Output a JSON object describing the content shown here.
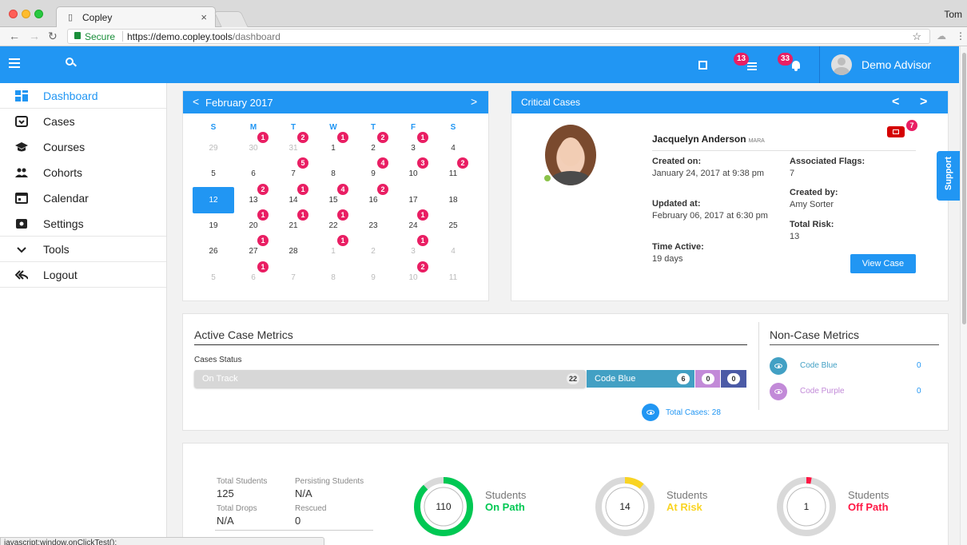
{
  "browser": {
    "tab_title": "Copley",
    "tab_close": "×",
    "profile_name": "Tom",
    "secure_label": "Secure",
    "url_base": "https://demo.copley.tools",
    "url_path": "/dashboard",
    "status_text": "javascript:window.onClickTest();"
  },
  "header": {
    "list_badge": "13",
    "bell_badge": "33",
    "user_name": "Demo Advisor",
    "accent_color": "#2196f3"
  },
  "sidebar": {
    "items": [
      {
        "label": "Dashboard",
        "icon": "dashboard-icon",
        "active": true
      },
      {
        "label": "Cases",
        "icon": "inbox-icon"
      },
      {
        "label": "Courses",
        "icon": "graduation-cap-icon"
      },
      {
        "label": "Cohorts",
        "icon": "group-icon"
      },
      {
        "label": "Calendar",
        "icon": "calendar-icon"
      },
      {
        "label": "Settings",
        "icon": "settings-icon"
      },
      {
        "label": "Tools",
        "icon": "chevron-down-icon"
      },
      {
        "label": "Logout",
        "icon": "reply-all-icon"
      }
    ]
  },
  "calendar": {
    "month": "February 2017",
    "prev": "<",
    "next": ">",
    "dow": [
      "S",
      "M",
      "T",
      "W",
      "T",
      "F",
      "S"
    ],
    "weeks": [
      [
        "29",
        "30",
        "31",
        "1",
        "2",
        "3",
        "4"
      ],
      [
        "5",
        "6",
        "7",
        "8",
        "9",
        "10",
        "11"
      ],
      [
        "12",
        "13",
        "14",
        "15",
        "16",
        "17",
        "18"
      ],
      [
        "19",
        "20",
        "21",
        "22",
        "23",
        "24",
        "25"
      ],
      [
        "26",
        "27",
        "28",
        "1",
        "2",
        "3",
        "4"
      ],
      [
        "5",
        "6",
        "7",
        "8",
        "9",
        "10",
        "11"
      ]
    ],
    "badges": [
      {
        "week": 0,
        "day": 1,
        "count": "1"
      },
      {
        "week": 0,
        "day": 2,
        "count": "2"
      },
      {
        "week": 0,
        "day": 3,
        "count": "1"
      },
      {
        "week": 0,
        "day": 4,
        "count": "2"
      },
      {
        "week": 0,
        "day": 5,
        "count": "1"
      },
      {
        "week": 1,
        "day": 2,
        "count": "5"
      },
      {
        "week": 1,
        "day": 4,
        "count": "4"
      },
      {
        "week": 1,
        "day": 5,
        "count": "3"
      },
      {
        "week": 1,
        "day": 6,
        "count": "2"
      },
      {
        "week": 2,
        "day": 1,
        "count": "2"
      },
      {
        "week": 2,
        "day": 2,
        "count": "1"
      },
      {
        "week": 2,
        "day": 3,
        "count": "4"
      },
      {
        "week": 2,
        "day": 4,
        "count": "2"
      },
      {
        "week": 3,
        "day": 1,
        "count": "1"
      },
      {
        "week": 3,
        "day": 2,
        "count": "1"
      },
      {
        "week": 3,
        "day": 3,
        "count": "1"
      },
      {
        "week": 3,
        "day": 5,
        "count": "1"
      },
      {
        "week": 4,
        "day": 1,
        "count": "1"
      },
      {
        "week": 4,
        "day": 3,
        "count": "1"
      },
      {
        "week": 4,
        "day": 5,
        "count": "1"
      },
      {
        "week": 5,
        "day": 1,
        "count": "1"
      },
      {
        "week": 5,
        "day": 5,
        "count": "2"
      }
    ]
  },
  "critical": {
    "title": "Critical Cases",
    "name": "Jacquelyn Anderson",
    "name_tag": "MARA",
    "flag_count": "7",
    "created_on_label": "Created on:",
    "created_on": "January 24, 2017 at 9:38 pm",
    "updated_at_label": "Updated at:",
    "updated_at": "February 06, 2017 at 6:30 pm",
    "time_active_label": "Time Active:",
    "time_active": "19 days",
    "assoc_flags_label": "Associated Flags:",
    "assoc_flags": "7",
    "created_by_label": "Created by:",
    "created_by": "Amy Sorter",
    "total_risk_label": "Total Risk:",
    "total_risk": "13",
    "view_button": "View Case",
    "prev": "<",
    "next": ">"
  },
  "support_label": "Support",
  "metrics": {
    "active_title": "Active Case Metrics",
    "cases_status_label": "Cases Status",
    "on_track_label": "On Track",
    "on_track_count": "22",
    "code_blue_label": "Code Blue",
    "code_blue_count": "6",
    "purple_count": "0",
    "indigo_count": "0",
    "total_cases": "Total Cases:  28",
    "noncase_title": "Non-Case Metrics",
    "noncase": [
      {
        "label": "Code Blue",
        "value": "0",
        "color": "#42a0c4"
      },
      {
        "label": "Code Purple",
        "value": "0",
        "color": "#c28ad8"
      }
    ]
  },
  "stats": {
    "total_students_label": "Total Students",
    "total_students": "125",
    "persisting_label": "Persisting Students",
    "persisting": "N/A",
    "total_drops_label": "Total Drops",
    "total_drops": "N/A",
    "rescued_label": "Rescued",
    "rescued": "0",
    "donuts": [
      {
        "value": "110",
        "title": "Students",
        "subtitle": "On Path",
        "color": "#00c853",
        "fraction": 0.88
      },
      {
        "value": "14",
        "title": "Students",
        "subtitle": "At Risk",
        "color": "#f9d423",
        "fraction": 0.11
      },
      {
        "value": "1",
        "title": "Students",
        "subtitle": "Off Path",
        "color": "#ff1744",
        "fraction": 0.01
      }
    ]
  }
}
